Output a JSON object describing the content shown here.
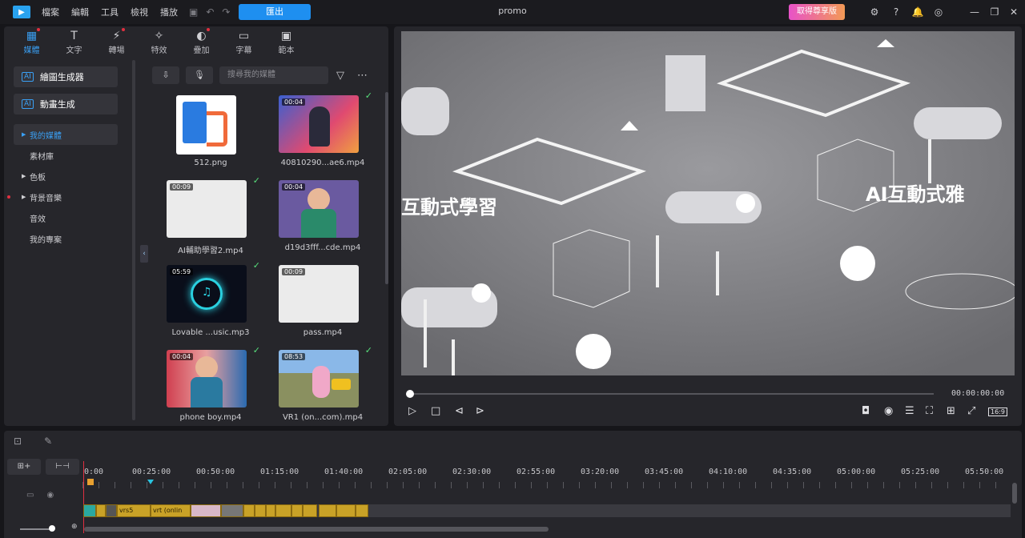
{
  "titlebar": {
    "menu": [
      "檔案",
      "編輯",
      "工具",
      "檢視",
      "播放"
    ],
    "export_label": "匯出",
    "project_name": "promo",
    "upgrade_label": "取得尊享版"
  },
  "tabs": [
    {
      "label": "媒體",
      "icon": "media-icon",
      "active": true,
      "dot": true
    },
    {
      "label": "文字",
      "icon": "text-icon",
      "active": false,
      "dot": false
    },
    {
      "label": "轉場",
      "icon": "transition-icon",
      "active": false,
      "dot": true
    },
    {
      "label": "特效",
      "icon": "effects-icon",
      "active": false,
      "dot": false
    },
    {
      "label": "疊加",
      "icon": "overlay-icon",
      "active": false,
      "dot": true
    },
    {
      "label": "字幕",
      "icon": "subtitle-icon",
      "active": false,
      "dot": false
    },
    {
      "label": "範本",
      "icon": "template-icon",
      "active": false,
      "dot": false
    }
  ],
  "sidebar": {
    "ai_image_label": "繪圖生成器",
    "ai_anim_label": "動畫生成",
    "items": [
      {
        "label": "我的媒體",
        "arrow": true,
        "active": true,
        "red": false
      },
      {
        "label": "素材庫",
        "arrow": false,
        "active": false,
        "red": false
      },
      {
        "label": "色板",
        "arrow": true,
        "active": false,
        "red": false
      },
      {
        "label": "背景音樂",
        "arrow": true,
        "active": false,
        "red": true
      },
      {
        "label": "音效",
        "arrow": false,
        "active": false,
        "red": false
      },
      {
        "label": "我的專案",
        "arrow": false,
        "active": false,
        "red": false
      }
    ]
  },
  "media": {
    "search_placeholder": "搜尋我的媒體",
    "items": [
      {
        "name": "512.png",
        "duration": "",
        "checked": false,
        "kind": "logo"
      },
      {
        "name": "40810290...ae6.mp4",
        "duration": "00:04",
        "checked": true,
        "kind": "vr"
      },
      {
        "name": "AI輔助學習2.mp4",
        "duration": "00:09",
        "checked": true,
        "kind": "blank"
      },
      {
        "name": "d19d3fff...cde.mp4",
        "duration": "00:04",
        "checked": false,
        "kind": "boy"
      },
      {
        "name": "Lovable ...usic.mp3",
        "duration": "05:59",
        "checked": true,
        "kind": "music"
      },
      {
        "name": "pass.mp4",
        "duration": "00:09",
        "checked": false,
        "kind": "blank"
      },
      {
        "name": "phone boy.mp4",
        "duration": "00:04",
        "checked": true,
        "kind": "phoneboy"
      },
      {
        "name": "VR1 (on...com).mp4",
        "duration": "08:53",
        "checked": true,
        "kind": "pig"
      }
    ]
  },
  "preview": {
    "text_left": "互動式學習",
    "text_right": "AI互動式雅",
    "timecode": "00:00:00:00",
    "aspect": "16:9"
  },
  "timeline": {
    "ruler": [
      "0:00",
      "00:25:00",
      "00:50:00",
      "01:15:00",
      "01:40:00",
      "02:05:00",
      "02:30:00",
      "02:55:00",
      "03:20:00",
      "03:45:00",
      "04:10:00",
      "04:35:00",
      "05:00:00",
      "05:25:00",
      "05:50:00"
    ],
    "clip_labels": [
      "vrs5",
      "vrt (onlin"
    ]
  }
}
